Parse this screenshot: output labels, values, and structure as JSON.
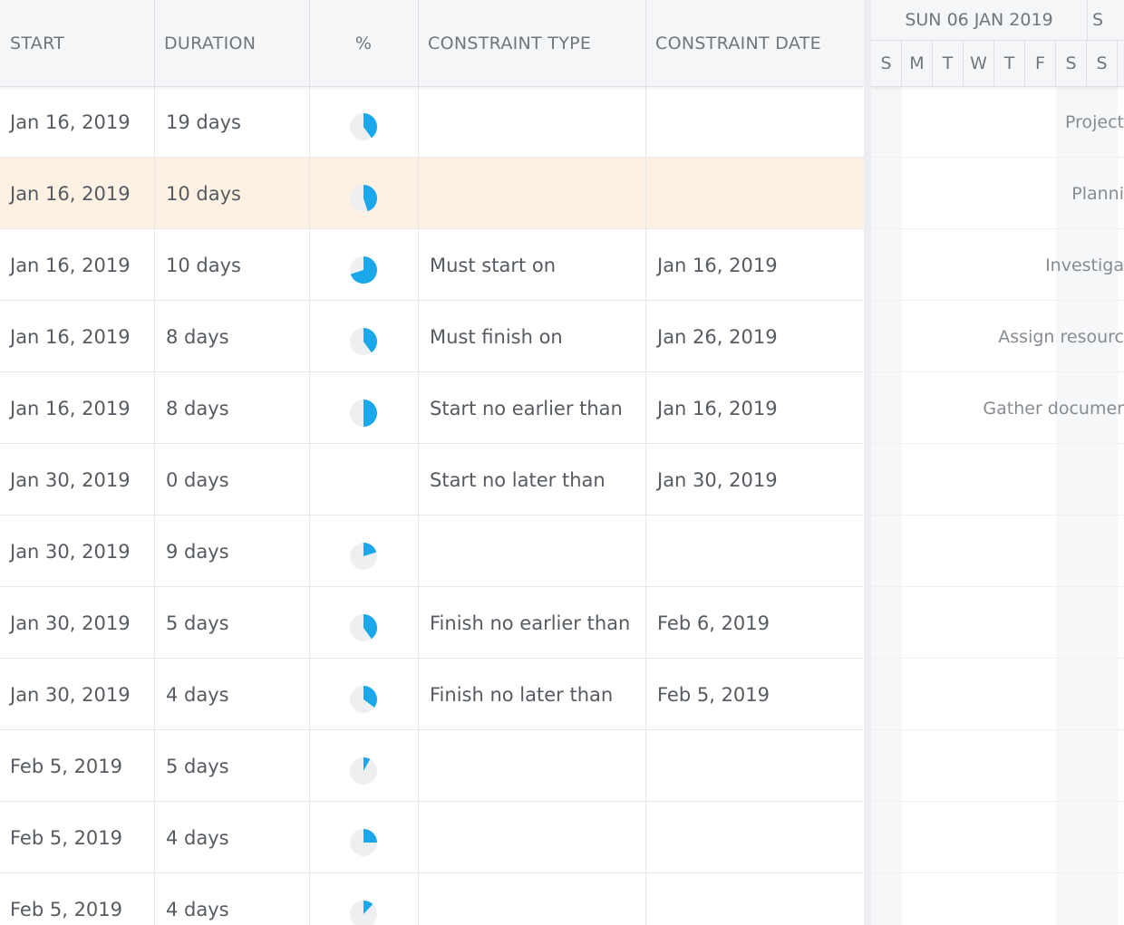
{
  "columns": {
    "start": "START",
    "duration": "DURATION",
    "percent": "%",
    "constraint_type": "CONSTRAINT TYPE",
    "constraint_date": "CONSTRAINT DATE"
  },
  "colors": {
    "progress": "#1ba8ea",
    "progress_bg": "#eeeff1",
    "selected_row": "#fdf1e4"
  },
  "rows": [
    {
      "start": "Jan 16, 2019",
      "duration": "19 days",
      "percent": 40,
      "constraint_type": "",
      "constraint_date": ""
    },
    {
      "start": "Jan 16, 2019",
      "duration": "10 days",
      "percent": 45,
      "constraint_type": "",
      "constraint_date": ""
    },
    {
      "start": "Jan 16, 2019",
      "duration": "10 days",
      "percent": 70,
      "constraint_type": "Must start on",
      "constraint_date": "Jan 16, 2019"
    },
    {
      "start": "Jan 16, 2019",
      "duration": "8 days",
      "percent": 40,
      "constraint_type": "Must finish on",
      "constraint_date": "Jan 26, 2019"
    },
    {
      "start": "Jan 16, 2019",
      "duration": "8 days",
      "percent": 50,
      "constraint_type": "Start no earlier than",
      "constraint_date": "Jan 16, 2019"
    },
    {
      "start": "Jan 30, 2019",
      "duration": "0 days",
      "percent": null,
      "constraint_type": "Start no later than",
      "constraint_date": "Jan 30, 2019"
    },
    {
      "start": "Jan 30, 2019",
      "duration": "9 days",
      "percent": 20,
      "constraint_type": "",
      "constraint_date": ""
    },
    {
      "start": "Jan 30, 2019",
      "duration": "5 days",
      "percent": 40,
      "constraint_type": "Finish no earlier than",
      "constraint_date": "Feb 6, 2019"
    },
    {
      "start": "Jan 30, 2019",
      "duration": "4 days",
      "percent": 35,
      "constraint_type": "Finish no later than",
      "constraint_date": "Feb 5, 2019"
    },
    {
      "start": "Feb 5, 2019",
      "duration": "5 days",
      "percent": 8,
      "constraint_type": "",
      "constraint_date": ""
    },
    {
      "start": "Feb 5, 2019",
      "duration": "4 days",
      "percent": 25,
      "constraint_type": "",
      "constraint_date": ""
    },
    {
      "start": "Feb 5, 2019",
      "duration": "4 days",
      "percent": 12,
      "constraint_type": "",
      "constraint_date": ""
    }
  ],
  "timeline": {
    "week1": "SUN 06 JAN 2019",
    "week2": "S",
    "days": [
      "S",
      "M",
      "T",
      "W",
      "T",
      "F",
      "S",
      "S"
    ],
    "task_labels": [
      "Project",
      "Planni",
      "Investiga",
      "Assign resourc",
      "Gather documer",
      "",
      "",
      "",
      "",
      "",
      "",
      ""
    ]
  }
}
